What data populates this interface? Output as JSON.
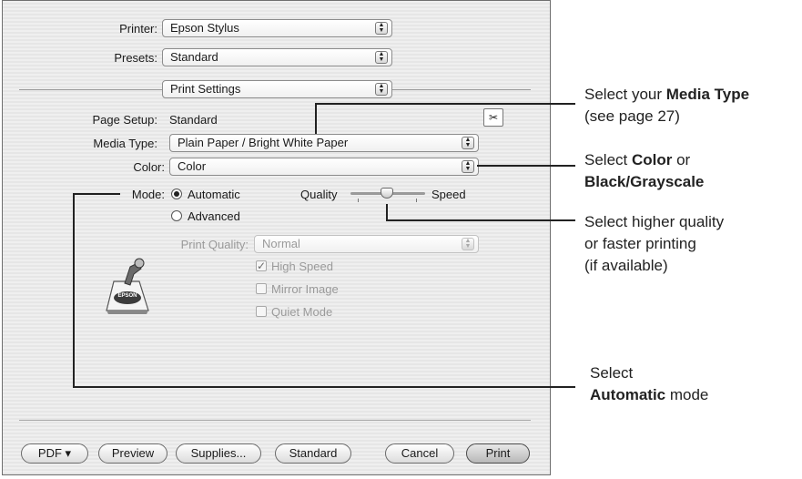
{
  "dialog": {
    "printer_label": "Printer:",
    "printer_value": "Epson Stylus",
    "presets_label": "Presets:",
    "presets_value": "Standard",
    "pane_value": "Print Settings",
    "page_setup_label": "Page Setup:",
    "page_setup_value": "Standard",
    "media_type_label": "Media Type:",
    "media_type_value": "Plain Paper / Bright White Paper",
    "color_label": "Color:",
    "color_value": "Color",
    "mode_label": "Mode:",
    "mode_automatic": "Automatic",
    "mode_advanced": "Advanced",
    "quality_label": "Quality",
    "speed_label": "Speed",
    "print_quality_label": "Print Quality:",
    "print_quality_value": "Normal",
    "high_speed_label": "High Speed",
    "mirror_image_label": "Mirror Image",
    "quiet_mode_label": "Quiet Mode",
    "logo_text": "EPSON"
  },
  "buttons": {
    "pdf": "PDF ▾",
    "preview": "Preview",
    "supplies": "Supplies...",
    "standard": "Standard",
    "cancel": "Cancel",
    "print": "Print"
  },
  "callouts": {
    "media_line1_pre": "Select your ",
    "media_line1_bold": "Media Type",
    "media_line2": "(see page 27)",
    "color_line1_pre": "Select ",
    "color_line1_bold": "Color",
    "color_line1_post": " or",
    "color_line2_bold": "Black/Grayscale",
    "quality_line1": "Select higher quality",
    "quality_line2": "or faster printing",
    "quality_line3": "(if available)",
    "auto_line1": "Select",
    "auto_line2_bold": "Automatic",
    "auto_line2_post": " mode"
  },
  "state": {
    "mode_selected": "Automatic",
    "high_speed_checked": true,
    "mirror_image_checked": false,
    "quiet_mode_checked": false
  }
}
